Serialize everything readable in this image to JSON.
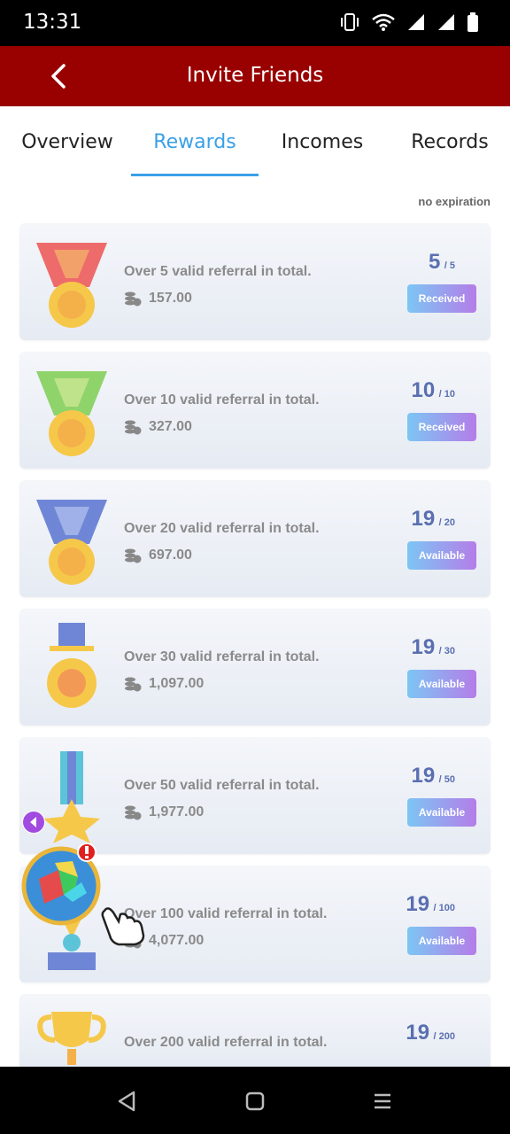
{
  "status_bar": {
    "time": "13:31",
    "icons": [
      "vibrate-icon",
      "wifi-icon",
      "signal-icon",
      "signal-icon",
      "battery-icon"
    ]
  },
  "header": {
    "title": "Invite Friends",
    "back_icon": "chevron-left-icon"
  },
  "tabs": [
    {
      "label": "Overview",
      "active": false
    },
    {
      "label": "Rewards",
      "active": true
    },
    {
      "label": "Incomes",
      "active": false
    },
    {
      "label": "Records",
      "active": false
    }
  ],
  "expiry_note": "no expiration",
  "rewards": [
    {
      "title": "Over 5 valid referral in total.",
      "amount": "157.00",
      "current": "5",
      "total": "/ 5",
      "button": "Received",
      "medal": "red-ribbon-medal-icon"
    },
    {
      "title": "Over 10 valid referral in total.",
      "amount": "327.00",
      "current": "10",
      "total": "/ 10",
      "button": "Received",
      "medal": "green-ribbon-medal-icon"
    },
    {
      "title": "Over 20 valid referral in total.",
      "amount": "697.00",
      "current": "19",
      "total": "/ 20",
      "button": "Available",
      "medal": "blue-ribbon-medal-icon"
    },
    {
      "title": "Over 30 valid referral in total.",
      "amount": "1,097.00",
      "current": "19",
      "total": "/ 30",
      "button": "Available",
      "medal": "hanging-medal-icon"
    },
    {
      "title": "Over 50 valid referral in total.",
      "amount": "1,977.00",
      "current": "19",
      "total": "/ 50",
      "button": "Available",
      "medal": "star-medal-icon"
    },
    {
      "title": "Over 100 valid referral in total.",
      "amount": "4,077.00",
      "current": "19",
      "total": "/ 100",
      "button": "Available",
      "medal": "award-medal-icon"
    },
    {
      "title": "Over 200 valid referral in total.",
      "amount": "",
      "current": "19",
      "total": "/ 200",
      "button": "",
      "medal": "trophy-icon"
    }
  ],
  "colors": {
    "header": "#990000",
    "accent": "#3aa0e8",
    "progress": "#5a6fb0",
    "text_muted": "#8a8a8a"
  }
}
